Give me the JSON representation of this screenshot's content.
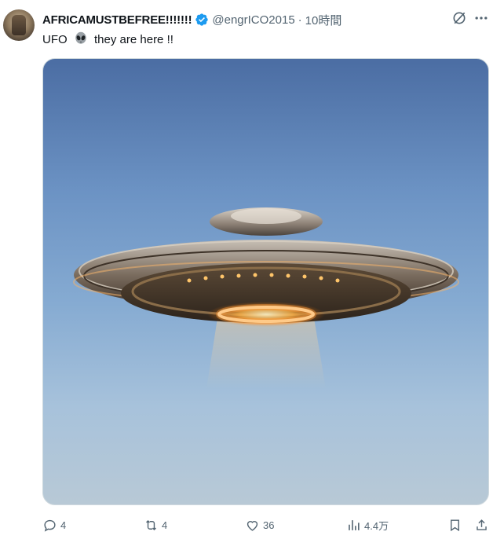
{
  "post": {
    "display_name": "AFRICAMUSTBEFREE!!!!!!!",
    "handle": "@engrICO2015",
    "separator": "·",
    "time": "10時間",
    "text_before": "UFO",
    "text_after": "they are here !!",
    "emoji": "alien-icon"
  },
  "media": {
    "subject": "flying-saucer",
    "sky_top": "#4b6da3",
    "sky_bottom": "#b8c9d6"
  },
  "actions": {
    "replies": "4",
    "reposts": "4",
    "likes": "36",
    "views": "4.4万"
  },
  "icons": {
    "verified": "verified-badge-icon",
    "grok": "grok-icon",
    "more": "more-dots-icon",
    "reply": "reply-icon",
    "repost": "repost-icon",
    "like": "heart-icon",
    "views": "views-icon",
    "bookmark": "bookmark-icon",
    "share": "share-icon"
  },
  "colors": {
    "verified_blue": "#1d9bf0",
    "text_primary": "#0f1419",
    "text_secondary": "#536471"
  }
}
